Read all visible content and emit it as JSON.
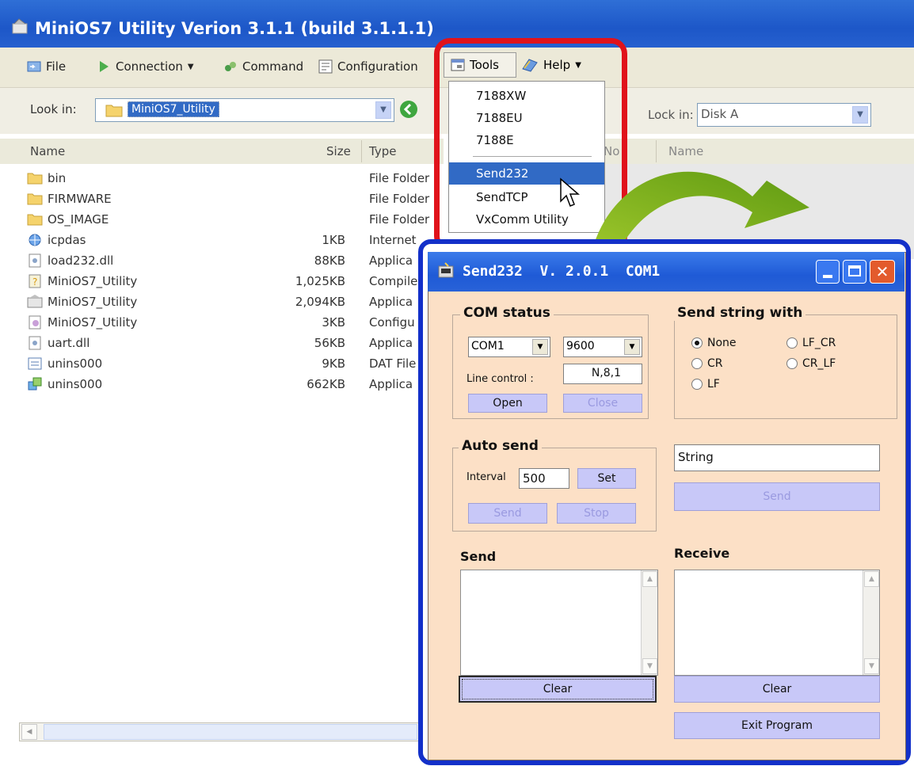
{
  "main": {
    "title": "MiniOS7 Utility Verion 3.1.1 (build 3.1.1.1)",
    "toolbar": {
      "file": "File",
      "connection": "Connection",
      "command": "Command",
      "configuration": "Configuration",
      "tools": "Tools",
      "help": "Help"
    },
    "look_in_label": "Look in:",
    "look_in_value": "MiniOS7_Utility",
    "right_look_in_label": "Lock in:",
    "right_look_in_value": "Disk A",
    "columns": {
      "name": "Name",
      "size": "Size",
      "type": "Type",
      "right_no": "No",
      "right_name": "Name"
    },
    "files": [
      {
        "name": "bin",
        "size": "",
        "type": "File Folder",
        "icon": "folder-icon"
      },
      {
        "name": "FIRMWARE",
        "size": "",
        "type": "File Folder",
        "icon": "folder-icon"
      },
      {
        "name": "OS_IMAGE",
        "size": "",
        "type": "File Folder",
        "icon": "folder-icon"
      },
      {
        "name": "icpdas",
        "size": "1KB",
        "type": "Internet",
        "icon": "internet-shortcut-icon"
      },
      {
        "name": "load232.dll",
        "size": "88KB",
        "type": "Applica",
        "icon": "dll-icon"
      },
      {
        "name": "MiniOS7_Utility",
        "size": "1,025KB",
        "type": "Compile",
        "icon": "help-file-icon"
      },
      {
        "name": "MiniOS7_Utility",
        "size": "2,094KB",
        "type": "Applica",
        "icon": "app-icon"
      },
      {
        "name": "MiniOS7_Utility",
        "size": "3KB",
        "type": "Configu",
        "icon": "config-icon"
      },
      {
        "name": "uart.dll",
        "size": "56KB",
        "type": "Applica",
        "icon": "dll-icon"
      },
      {
        "name": "unins000",
        "size": "9KB",
        "type": "DAT File",
        "icon": "dat-icon"
      },
      {
        "name": "unins000",
        "size": "662KB",
        "type": "Applica",
        "icon": "installer-icon"
      }
    ]
  },
  "tools_menu": {
    "items": [
      "7188XW",
      "7188EU",
      "7188E",
      "Send232",
      "SendTCP",
      "VxComm Utility"
    ],
    "highlighted": "Send232"
  },
  "dialog": {
    "title": "Send232  V. 2.0.1  COM1",
    "com_status": {
      "label": "COM status",
      "port": "COM1",
      "baud": "9600",
      "line_control_label": "Line control :",
      "line_control_value": "N,8,1",
      "open": "Open",
      "close": "Close"
    },
    "send_string_with": {
      "label": "Send string with",
      "options": [
        "None",
        "LF_CR",
        "CR",
        "CR_LF",
        "LF"
      ],
      "selected": "None"
    },
    "auto_send": {
      "label": "Auto send",
      "interval_label": "Interval",
      "interval_value": "500",
      "set": "Set",
      "send": "Send",
      "stop": "Stop"
    },
    "string_value": "String",
    "send_button": "Send",
    "send_label": "Send",
    "receive_label": "Receive",
    "clear_send": "Clear",
    "clear_receive": "Clear",
    "exit": "Exit Program"
  },
  "colors": {
    "highlight_red": "#e0131b",
    "dialog_border_blue": "#1330c9",
    "arrow_green": "#7cb518",
    "dialog_bg": "#fce0c6"
  }
}
